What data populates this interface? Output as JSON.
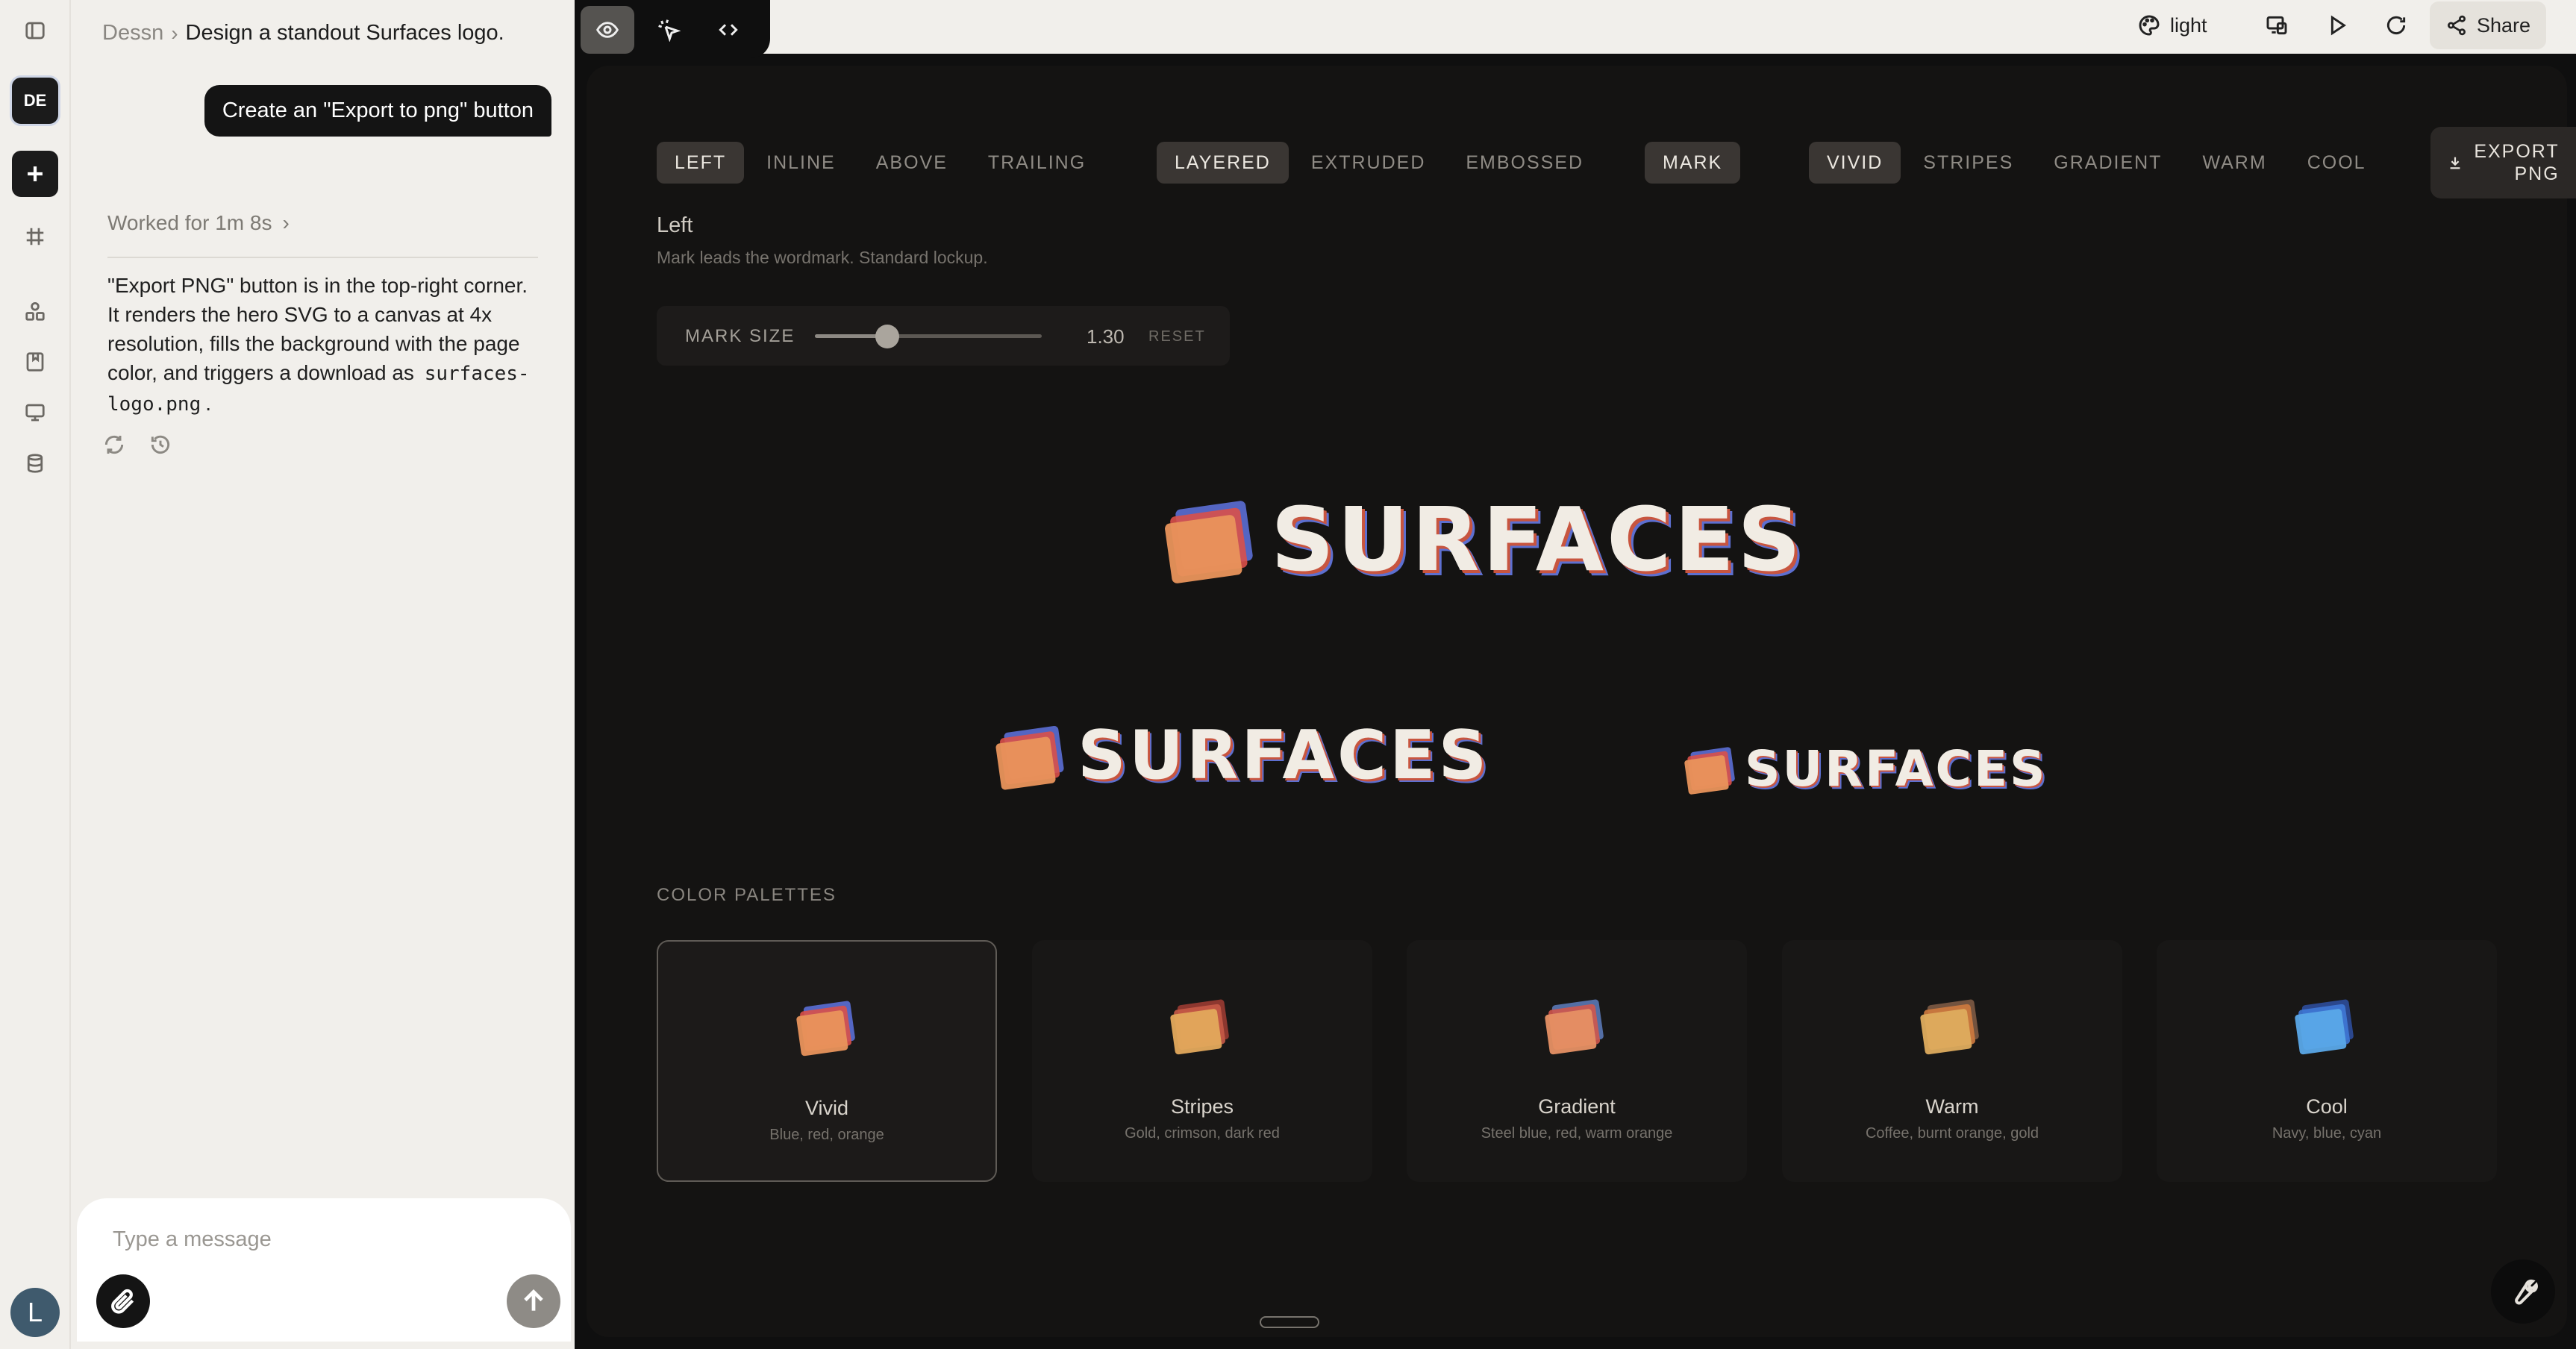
{
  "project": {
    "workspace": "Dessn",
    "title": "Design a standout Surfaces logo."
  },
  "rail": {
    "workspace_badge": "DE",
    "user_initial": "L"
  },
  "chat": {
    "user_message": "Create an \"Export to png\" button",
    "worked_label": "Worked for 1m 8s",
    "reply_text": "\"Export PNG\" button is in the top-right corner. It renders the hero SVG to a canvas at 4x resolution, fills the background with the page color, and triggers a download as",
    "reply_code": "surfaces-logo.png",
    "reply_end": ".",
    "composer_placeholder": "Type a message"
  },
  "topbar": {
    "theme_label": "light",
    "share_label": "Share"
  },
  "canvas": {
    "layout_options": [
      "LEFT",
      "INLINE",
      "ABOVE",
      "TRAILING"
    ],
    "layout_selected": "LEFT",
    "style_options": [
      "LAYERED",
      "EXTRUDED",
      "EMBOSSED"
    ],
    "style_selected": "LAYERED",
    "mark_toggle": "MARK",
    "palette_options": [
      "VIVID",
      "STRIPES",
      "GRADIENT",
      "WARM",
      "COOL"
    ],
    "palette_selected": "VIVID",
    "export_label_1": "EXPORT",
    "export_label_2": "PNG",
    "layout_name": "Left",
    "layout_description": "Mark leads the wordmark. Standard lockup.",
    "mark_size": {
      "label": "MARK SIZE",
      "value": "1.30",
      "value_num": 1.3,
      "min": 0.5,
      "max": 3.0,
      "reset_label": "RESET"
    },
    "wordmark": "SURFACES",
    "palettes_heading": "COLOR PALETTES",
    "palettes": [
      {
        "name": "Vivid",
        "desc": "Blue, red, orange",
        "colors": [
          "#5b6fd6",
          "#d9504a",
          "#e9935c"
        ],
        "selected": true
      },
      {
        "name": "Stripes",
        "desc": "Gold, crimson, dark red",
        "colors": [
          "#9a3b32",
          "#c65a47",
          "#e3a95c"
        ],
        "selected": false
      },
      {
        "name": "Gradient",
        "desc": "Steel blue, red, warm orange",
        "colors": [
          "#5a78b5",
          "#d0574c",
          "#e69064"
        ],
        "selected": false
      },
      {
        "name": "Warm",
        "desc": "Coffee, burnt orange, gold",
        "colors": [
          "#7d5a44",
          "#cf7a3e",
          "#deac5e"
        ],
        "selected": false
      },
      {
        "name": "Cool",
        "desc": "Navy, blue, cyan",
        "colors": [
          "#2d4c9a",
          "#3f78d6",
          "#5aa8e8"
        ],
        "selected": false
      }
    ]
  }
}
